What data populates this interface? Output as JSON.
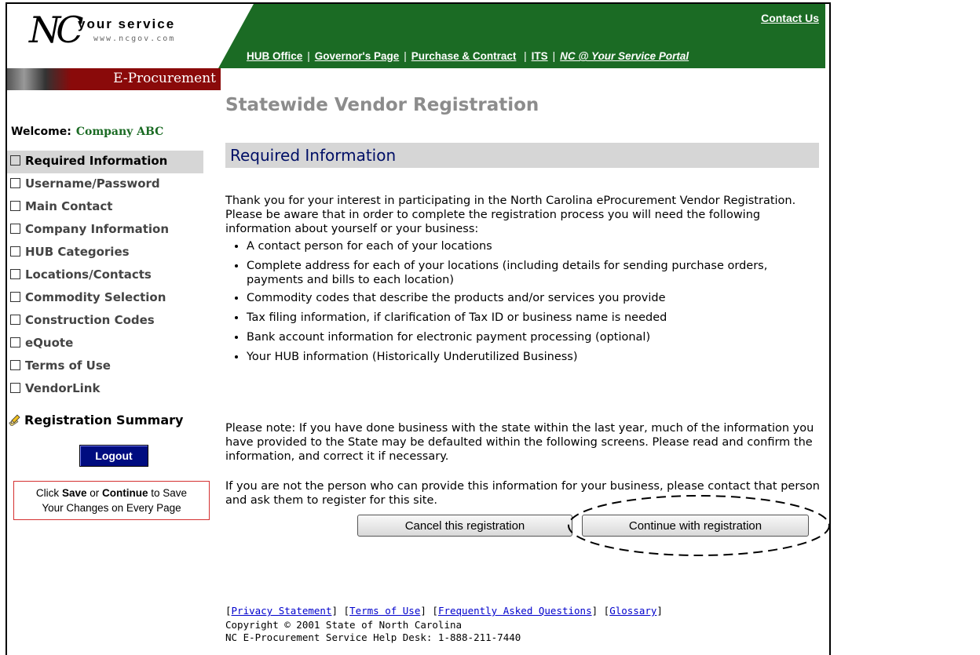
{
  "header": {
    "logo_nc": "NC",
    "logo_text": "your service",
    "logo_url": "www.ncgov.com",
    "eproc_label": "E-Procurement",
    "contact_us": "Contact Us",
    "topnav": [
      "HUB Office",
      "Governor's Page",
      "Purchase & Contract",
      "ITS",
      "NC @ Your Service Portal"
    ]
  },
  "page_title": "Statewide Vendor Registration",
  "sidebar": {
    "welcome_label": "Welcome:",
    "company": "Company ABC",
    "items": [
      {
        "label": "Required Information",
        "active": true
      },
      {
        "label": "Username/Password"
      },
      {
        "label": "Main Contact"
      },
      {
        "label": "Company Information"
      },
      {
        "label": "HUB Categories"
      },
      {
        "label": "Locations/Contacts"
      },
      {
        "label": "Commodity Selection"
      },
      {
        "label": "Construction Codes"
      },
      {
        "label": "eQuote"
      },
      {
        "label": "Terms of Use"
      },
      {
        "label": "VendorLink"
      }
    ],
    "registration_summary": "Registration Summary",
    "logout": "Logout",
    "save_note_1": "Click",
    "save_note_save": "Save",
    "save_note_or": "or",
    "save_note_continue": "Continue",
    "save_note_2": "to Save",
    "save_note_3": "Your Changes on Every Page"
  },
  "main": {
    "section_title": "Required Information",
    "intro": "Thank you for your interest in participating in the North Carolina eProcurement Vendor Registration. Please be aware that in order to complete the registration process you will need the following information about yourself or your business:",
    "bullets": [
      "A contact person for each of your locations",
      "Complete address for each of your locations (including details for sending purchase orders, payments and bills to each location)",
      "Commodity codes that describe the products and/or services you provide",
      "Tax filing information, if clarification of Tax ID or business name is needed",
      "Bank account information for electronic payment processing (optional)",
      "Your HUB information (Historically Underutilized Business)"
    ],
    "note": "Please note: If you have done business with the state within the last year, much of the information you have provided to the State may be defaulted within the following screens. Please read and confirm the information, and correct it if necessary.",
    "not_person": "If you are not the person who can provide this information for your business, please contact that person and ask them to register for this site.",
    "cancel_button": "Cancel this registration",
    "continue_button": "Continue with registration"
  },
  "footer": {
    "links": [
      "Privacy Statement",
      "Terms of Use",
      "Frequently Asked Questions",
      "Glossary"
    ],
    "copyright": "Copyright © 2001 State of North Carolina",
    "helpdesk": "NC E-Procurement Service Help Desk: 1-888-211-7440"
  }
}
